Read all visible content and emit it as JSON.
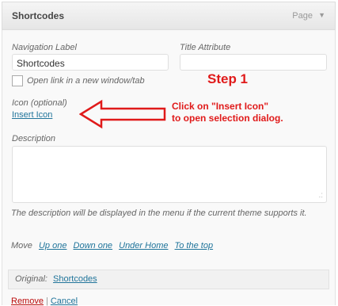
{
  "header": {
    "title": "Shortcodes",
    "type": "Page",
    "toggle_icon": "triangle-down-icon"
  },
  "form": {
    "nav_label": {
      "label": "Navigation Label",
      "value": "Shortcodes"
    },
    "title_attr": {
      "label": "Title Attribute",
      "value": ""
    },
    "new_window": {
      "label": "Open link in a new window/tab",
      "checked": false
    },
    "icon": {
      "label": "Icon (optional)",
      "link": "Insert Icon"
    },
    "description": {
      "label": "Description",
      "value": ""
    },
    "help_text": "The description will be displayed in the menu if the current theme supports it.",
    "move": {
      "label": "Move",
      "links": [
        "Up one",
        "Down one",
        "Under Home",
        "To the top"
      ]
    },
    "original": {
      "label": "Original:",
      "link": "Shortcodes"
    },
    "actions": {
      "remove": "Remove",
      "separator": "|",
      "cancel": "Cancel"
    }
  },
  "annotation": {
    "step": "Step 1",
    "line1": "Click on \"Insert Icon\"",
    "line2": "to open selection dialog.",
    "color": "#e01a1a"
  }
}
